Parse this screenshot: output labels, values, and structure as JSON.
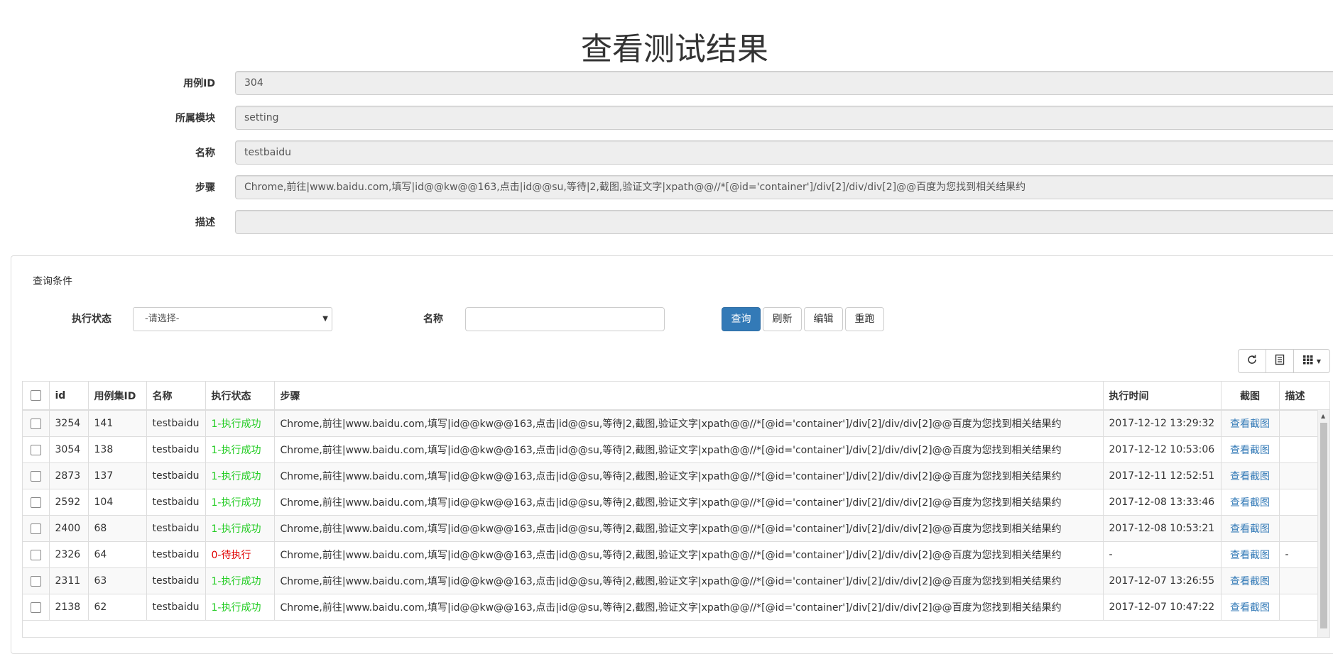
{
  "page_title": "查看测试结果",
  "form": {
    "fields": [
      {
        "label": "用例ID",
        "value": "304"
      },
      {
        "label": "所属模块",
        "value": "setting"
      },
      {
        "label": "名称",
        "value": "testbaidu"
      },
      {
        "label": "步骤",
        "value": "Chrome,前往|www.baidu.com,填写|id@@kw@@163,点击|id@@su,等待|2,截图,验证文字|xpath@@//*[@id='container']/div[2]/div/div[2]@@百度为您找到相关结果约"
      },
      {
        "label": "描述",
        "value": ""
      }
    ]
  },
  "query": {
    "heading": "查询条件",
    "status_label": "执行状态",
    "status_selected": "-请选择-",
    "name_label": "名称",
    "name_value": "",
    "buttons": {
      "search": "查询",
      "refresh": "刷新",
      "edit": "编辑",
      "rerun": "重跑"
    }
  },
  "toolbar": {
    "icons": [
      "refresh-icon",
      "list-toggle-icon",
      "columns-icon",
      "caret-down-icon"
    ]
  },
  "table": {
    "headers": [
      "id",
      "用例集ID",
      "名称",
      "执行状态",
      "步骤",
      "执行时间",
      "截图",
      "描述"
    ],
    "rows": [
      {
        "id": "3254",
        "suite_id": "141",
        "name": "testbaidu",
        "status": "1-执行成功",
        "status_type": "ok",
        "steps": "Chrome,前往|www.baidu.com,填写|id@@kw@@163,点击|id@@su,等待|2,截图,验证文字|xpath@@//*[@id='container']/div[2]/div/div[2]@@百度为您找到相关结果约",
        "time": "2017-12-12 13:29:32",
        "shot": "查看截图",
        "desc": ""
      },
      {
        "id": "3054",
        "suite_id": "138",
        "name": "testbaidu",
        "status": "1-执行成功",
        "status_type": "ok",
        "steps": "Chrome,前往|www.baidu.com,填写|id@@kw@@163,点击|id@@su,等待|2,截图,验证文字|xpath@@//*[@id='container']/div[2]/div/div[2]@@百度为您找到相关结果约",
        "time": "2017-12-12 10:53:06",
        "shot": "查看截图",
        "desc": ""
      },
      {
        "id": "2873",
        "suite_id": "137",
        "name": "testbaidu",
        "status": "1-执行成功",
        "status_type": "ok",
        "steps": "Chrome,前往|www.baidu.com,填写|id@@kw@@163,点击|id@@su,等待|2,截图,验证文字|xpath@@//*[@id='container']/div[2]/div/div[2]@@百度为您找到相关结果约",
        "time": "2017-12-11 12:52:51",
        "shot": "查看截图",
        "desc": ""
      },
      {
        "id": "2592",
        "suite_id": "104",
        "name": "testbaidu",
        "status": "1-执行成功",
        "status_type": "ok",
        "steps": "Chrome,前往|www.baidu.com,填写|id@@kw@@163,点击|id@@su,等待|2,截图,验证文字|xpath@@//*[@id='container']/div[2]/div/div[2]@@百度为您找到相关结果约",
        "time": "2017-12-08 13:33:46",
        "shot": "查看截图",
        "desc": ""
      },
      {
        "id": "2400",
        "suite_id": "68",
        "name": "testbaidu",
        "status": "1-执行成功",
        "status_type": "ok",
        "steps": "Chrome,前往|www.baidu.com,填写|id@@kw@@163,点击|id@@su,等待|2,截图,验证文字|xpath@@//*[@id='container']/div[2]/div/div[2]@@百度为您找到相关结果约",
        "time": "2017-12-08 10:53:21",
        "shot": "查看截图",
        "desc": ""
      },
      {
        "id": "2326",
        "suite_id": "64",
        "name": "testbaidu",
        "status": "0-待执行",
        "status_type": "pending",
        "steps": "Chrome,前往|www.baidu.com,填写|id@@kw@@163,点击|id@@su,等待|2,截图,验证文字|xpath@@//*[@id='container']/div[2]/div/div[2]@@百度为您找到相关结果约",
        "time": "-",
        "shot": "查看截图",
        "desc": "-"
      },
      {
        "id": "2311",
        "suite_id": "63",
        "name": "testbaidu",
        "status": "1-执行成功",
        "status_type": "ok",
        "steps": "Chrome,前往|www.baidu.com,填写|id@@kw@@163,点击|id@@su,等待|2,截图,验证文字|xpath@@//*[@id='container']/div[2]/div/div[2]@@百度为您找到相关结果约",
        "time": "2017-12-07 13:26:55",
        "shot": "查看截图",
        "desc": ""
      },
      {
        "id": "2138",
        "suite_id": "62",
        "name": "testbaidu",
        "status": "1-执行成功",
        "status_type": "ok",
        "steps": "Chrome,前往|www.baidu.com,填写|id@@kw@@163,点击|id@@su,等待|2,截图,验证文字|xpath@@//*[@id='container']/div[2]/div/div[2]@@百度为您找到相关结果约",
        "time": "2017-12-07 10:47:22",
        "shot": "查看截图",
        "desc": ""
      }
    ]
  },
  "colors": {
    "primary": "#337ab7",
    "success": "#22cc22",
    "danger": "#e00000"
  }
}
